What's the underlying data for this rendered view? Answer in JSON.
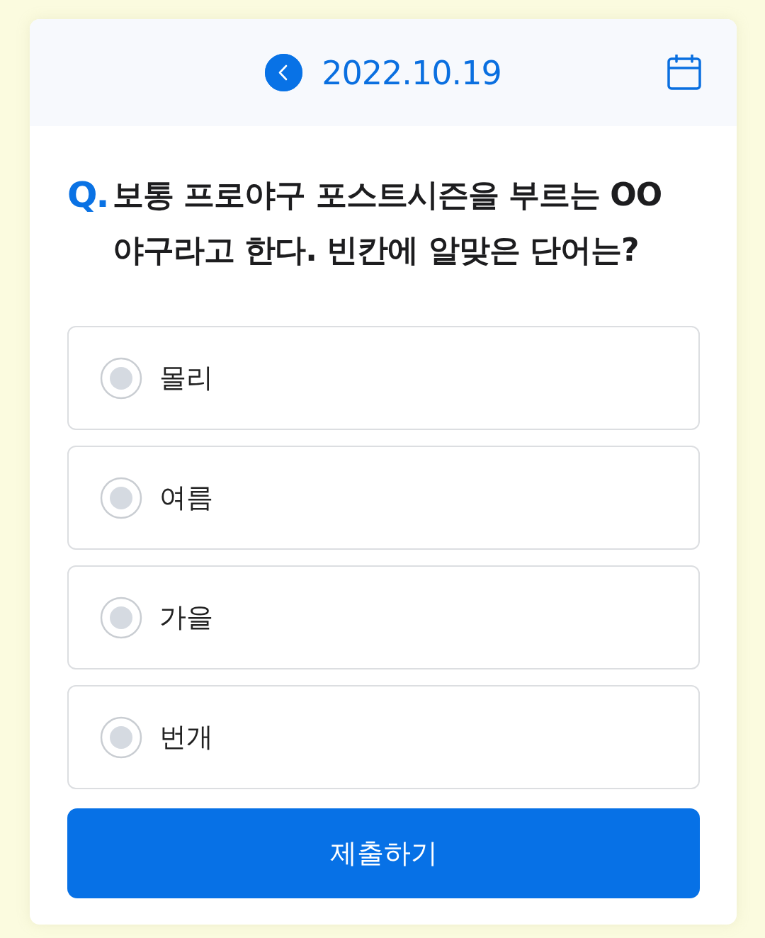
{
  "header": {
    "date": "2022.10.19"
  },
  "question": {
    "prefix": "Q.",
    "text": "보통 프로야구 포스트시즌을 부르는 OO 야구라고 한다. 빈칸에 알맞은 단어는?"
  },
  "options": [
    {
      "label": "몰리",
      "selected": false
    },
    {
      "label": "여름",
      "selected": false
    },
    {
      "label": "가을",
      "selected": false
    },
    {
      "label": "번개",
      "selected": false
    }
  ],
  "submit_button": {
    "label": "제출하기"
  }
}
